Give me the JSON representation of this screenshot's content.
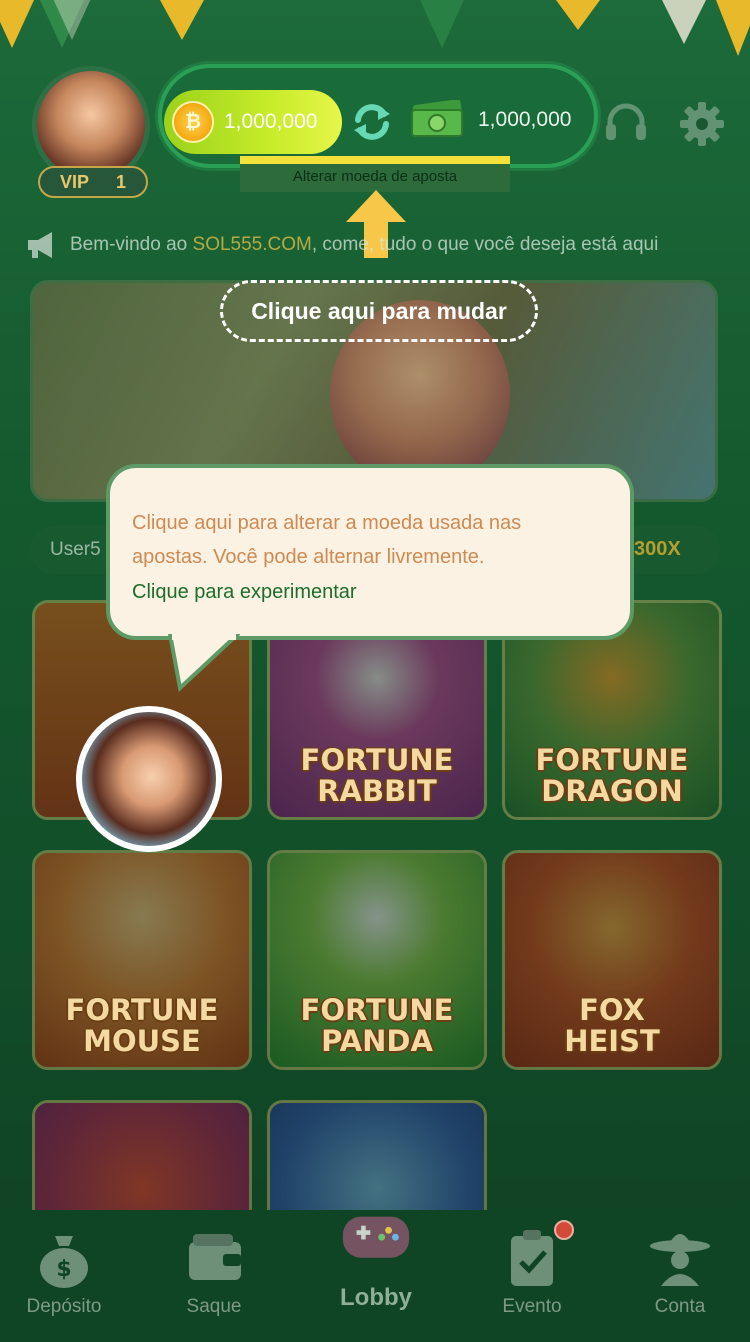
{
  "colors": {
    "accent_green": "#2aa057",
    "coin_yellow": "#f5ab15",
    "highlight_gold": "#e8c34a",
    "tooltip_orange": "#cf8a51",
    "tooltip_green": "#1d6d2c"
  },
  "header": {
    "vip_label": "VIP",
    "vip_level": "1",
    "coin_balance": "1,000,000",
    "cash_balance": "1,000,000",
    "coin_icon": "coin-icon",
    "swap_icon": "swap-icon",
    "cash_icon": "cash-icon",
    "support_icon": "headset-icon",
    "settings_icon": "gear-icon"
  },
  "currency_switch": {
    "label": "Alterar moeda de aposta"
  },
  "notice": {
    "icon": "megaphone-icon",
    "prefix": "Bem-vindo ao ",
    "brand": "SOL555.COM",
    "suffix": ", come, tudo o que você deseja está aqui"
  },
  "banner": {
    "hint": "Clique aqui para mudar"
  },
  "winner_ticker": {
    "user": "User5",
    "multiplier": "300X"
  },
  "games": [
    {
      "title_line1": "",
      "title_line2": ""
    },
    {
      "title_line1": "FORTUNE",
      "title_line2": "RABBIT"
    },
    {
      "title_line1": "FORTUNE",
      "title_line2": "DRAGON"
    },
    {
      "title_line1": "FORTUNE",
      "title_line2": "MOUSE"
    },
    {
      "title_line1": "FORTUNE",
      "title_line2": "PANDA"
    },
    {
      "title_line1": "FOX",
      "title_line2": "HEIST"
    }
  ],
  "tooltip": {
    "line1": "Clique aqui para alterar a moeda usada nas",
    "line2": "apostas. Você pode alternar livremente.",
    "cta": "Clique para experimentar"
  },
  "nav": {
    "deposit": "Depósito",
    "withdraw": "Saque",
    "lobby": "Lobby",
    "event": "Evento",
    "account": "Conta"
  }
}
